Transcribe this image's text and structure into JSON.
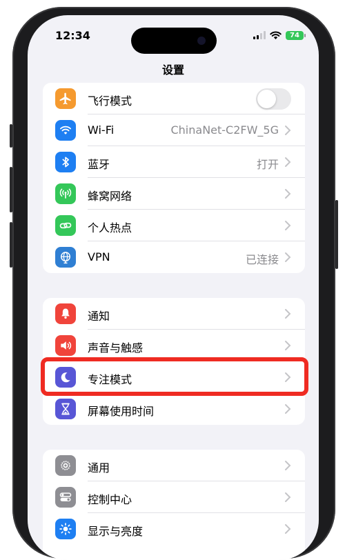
{
  "status_bar": {
    "time": "12:34",
    "battery": "74"
  },
  "nav": {
    "title": "设置"
  },
  "groups": [
    {
      "items": [
        {
          "label": "飞行模式",
          "icon": "airplane-icon",
          "color": "#f59a2f",
          "toggle": "off"
        },
        {
          "label": "Wi-Fi",
          "icon": "wifi-icon",
          "color": "#1e7ff2",
          "value": "ChinaNet-C2FW_5G"
        },
        {
          "label": "蓝牙",
          "icon": "bluetooth-icon",
          "color": "#1e7ff2",
          "value": "打开"
        },
        {
          "label": "蜂窝网络",
          "icon": "cellular-icon",
          "color": "#34c759"
        },
        {
          "label": "个人热点",
          "icon": "hotspot-icon",
          "color": "#34c759"
        },
        {
          "label": "VPN",
          "icon": "vpn-globe-icon",
          "color": "#2f7fd3",
          "value": "已连接"
        }
      ]
    },
    {
      "items": [
        {
          "label": "通知",
          "icon": "bell-icon",
          "color": "#f0443b"
        },
        {
          "label": "声音与触感",
          "icon": "speaker-icon",
          "color": "#f0443b"
        },
        {
          "label": "专注模式",
          "icon": "moon-icon",
          "color": "#5856d6"
        },
        {
          "label": "屏幕使用时间",
          "icon": "hourglass-icon",
          "color": "#5856d6"
        }
      ]
    },
    {
      "items": [
        {
          "label": "通用",
          "icon": "gear-icon",
          "color": "#8e8e93"
        },
        {
          "label": "控制中心",
          "icon": "switches-icon",
          "color": "#8e8e93"
        },
        {
          "label": "显示与亮度",
          "icon": "sun-icon",
          "color": "#1e7ff2"
        }
      ]
    }
  ],
  "highlight_color": "#ef2b22"
}
